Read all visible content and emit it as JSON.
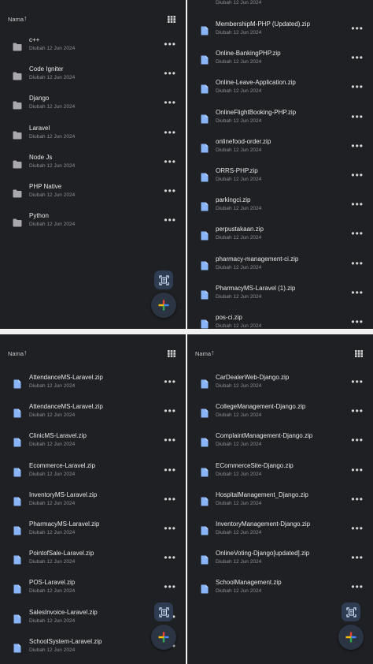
{
  "colors": {
    "panel_bg": "#1f2023",
    "folder_icon": "#a9a9ad",
    "file_icon": "#8ab4f8",
    "text": "#e8e8e8",
    "subtext": "#8f8f94"
  },
  "panels": {
    "top_left": {
      "sort_label": "Nama",
      "rows": [
        {
          "name": "c++",
          "sub": "Diubah 12 Jun 2024"
        },
        {
          "name": "Code Igniter",
          "sub": "Diubah 12 Jun 2024"
        },
        {
          "name": "Django",
          "sub": "Diubah 12 Jun 2024"
        },
        {
          "name": "Laravel",
          "sub": "Diubah 12 Jun 2024"
        },
        {
          "name": "Node Js",
          "sub": "Diubah 12 Jun 2024"
        },
        {
          "name": "PHP Native",
          "sub": "Diubah 12 Jun 2024"
        },
        {
          "name": "Python",
          "sub": "Diubah 12 Jun 2024"
        }
      ]
    },
    "top_right": {
      "top_sub": "Diubah 12 Jun 2024",
      "rows": [
        {
          "name": "MembershipM-PHP (Updated).zip",
          "sub": "Diubah 12 Jun 2024"
        },
        {
          "name": "Online-BankingPHP.zip",
          "sub": "Diubah 12 Jun 2024"
        },
        {
          "name": "Online-Leave-Application.zip",
          "sub": "Diubah 12 Jun 2024"
        },
        {
          "name": "OnlineFlightBooking-PHP.zip",
          "sub": "Diubah 12 Jun 2024"
        },
        {
          "name": "onlinefood-order.zip",
          "sub": "Diubah 12 Jun 2024"
        },
        {
          "name": "ORRS-PHP.zip",
          "sub": "Diubah 12 Jun 2024"
        },
        {
          "name": "parkingci.zip",
          "sub": "Diubah 12 Jun 2024"
        },
        {
          "name": "perpustakaan.zip",
          "sub": "Diubah 12 Jun 2024"
        },
        {
          "name": "pharmacy-management-ci.zip",
          "sub": "Diubah 12 Jun 2024"
        },
        {
          "name": "PharmacyMS-Laravel (1).zip",
          "sub": "Diubah 12 Jun 2024"
        },
        {
          "name": "pos-ci.zip",
          "sub": "Diubah 12 Jun 2024"
        }
      ]
    },
    "bottom_left": {
      "sort_label": "Nama",
      "rows": [
        {
          "name": "AttendanceMS-Laravel.zip",
          "sub": "Diubah 12 Jun 2024"
        },
        {
          "name": "AttendanceMS-Laravel.zip",
          "sub": "Diubah 12 Jun 2024"
        },
        {
          "name": "ClinicMS-Laravel.zip",
          "sub": "Diubah 12 Jun 2024"
        },
        {
          "name": "Ecommerce-Laravel.zip",
          "sub": "Diubah 12 Jun 2024"
        },
        {
          "name": "InventoryMS-Laravel.zip",
          "sub": "Diubah 12 Jun 2024"
        },
        {
          "name": "PharmacyMS-Laravel.zip",
          "sub": "Diubah 12 Jun 2024"
        },
        {
          "name": "PointofSale-Laravel.zip",
          "sub": "Diubah 12 Jun 2024"
        },
        {
          "name": "POS-Laravel.zip",
          "sub": "Diubah 12 Jun 2024"
        },
        {
          "name": "SalesInvoice-Laravel.zip",
          "sub": "Diubah 12 Jun 2024"
        },
        {
          "name": "SchoolSystem-Laravel.zip",
          "sub": "Diubah 12 Jun 2024"
        }
      ]
    },
    "bottom_right": {
      "sort_label": "Nama",
      "rows": [
        {
          "name": "CarDealerWeb-Django.zip",
          "sub": "Diubah 12 Jun 2024"
        },
        {
          "name": "CollegeManagement-Django.zip",
          "sub": "Diubah 12 Jun 2024"
        },
        {
          "name": "ComplaintManagement-Django.zip",
          "sub": "Diubah 12 Jun 2024"
        },
        {
          "name": "ECommerceSite-Django.zip",
          "sub": "Diubah 12 Jun 2024"
        },
        {
          "name": "HospitalManagement_Django.zip",
          "sub": "Diubah 12 Jun 2024"
        },
        {
          "name": "InventoryManagement-Django.zip",
          "sub": "Diubah 12 Jun 2024"
        },
        {
          "name": "OnlineVoting-Django[updated].zip",
          "sub": "Diubah 12 Jun 2024"
        },
        {
          "name": "SchoolManagement.zip",
          "sub": "Diubah 12 Jun 2024"
        }
      ]
    }
  },
  "icons": {
    "folder": "folder-icon",
    "file": "file-icon",
    "more": "more-horizontal-icon",
    "grid": "grid-view-icon",
    "scan": "scan-document-icon",
    "new": "new-plus-icon"
  },
  "more_glyph": "•••",
  "sort_arrow": "↑"
}
